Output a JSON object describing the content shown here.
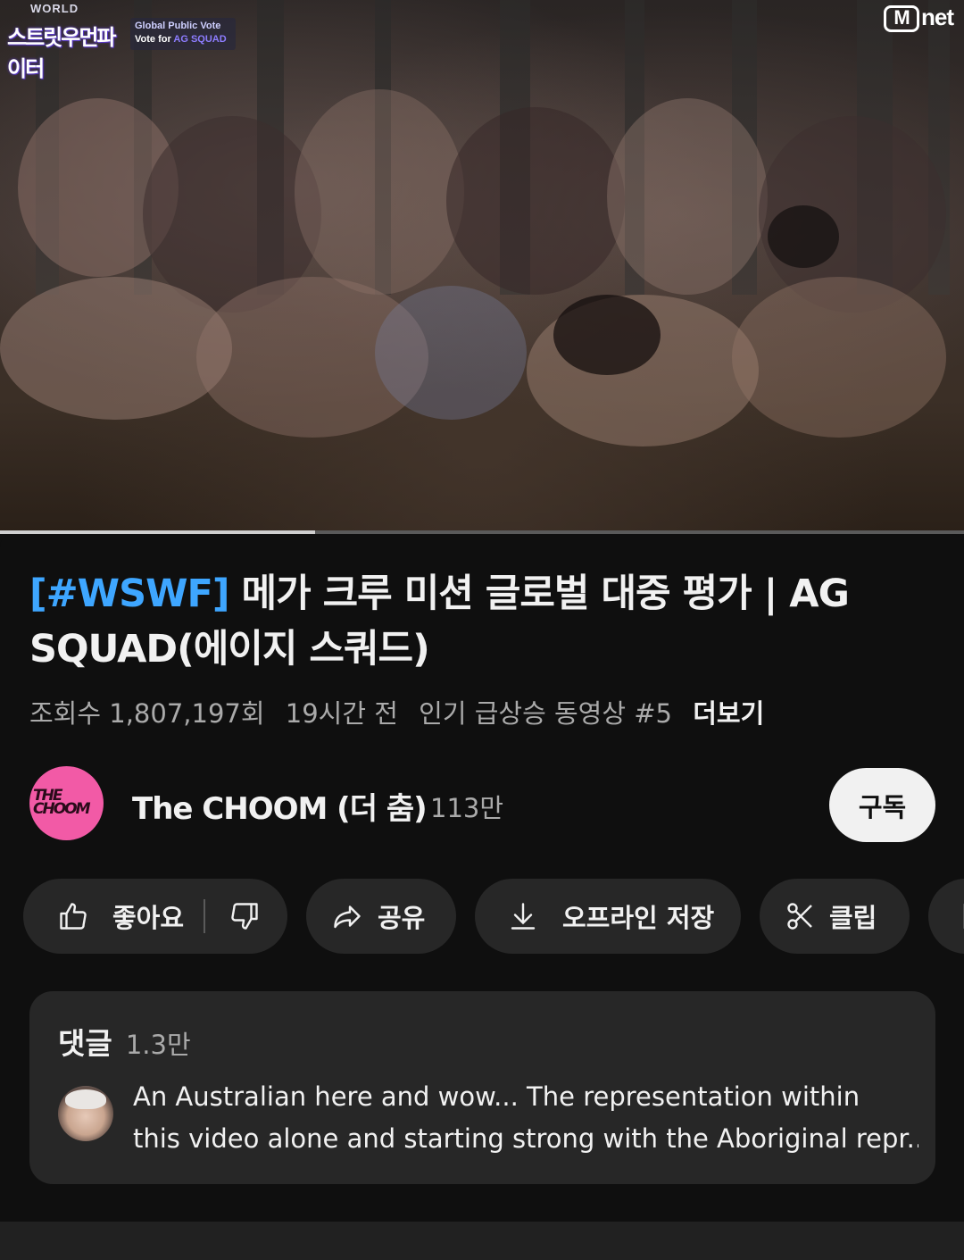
{
  "player": {
    "show_logo_top": "WORLD",
    "show_logo_main": "스트릿우먼파이터",
    "vote_line1": "Global Public Vote",
    "vote_line2_prefix": "Vote for ",
    "vote_line2_highlight": "AG SQUAD",
    "broadcaster_logo_m": "M",
    "broadcaster_logo_rest": "net",
    "progress": 0.327
  },
  "video": {
    "title_tag": "[#WSWF]",
    "title_text": " 메가 크루 미션 글로벌 대중 평가 | AG SQUAD(에이지 스쿼드)",
    "views": "조회수 1,807,197회",
    "time": "19시간 전",
    "trending": "인기 급상승 동영상 #5",
    "more": "더보기"
  },
  "channel": {
    "avatar_text_line1": "THE",
    "avatar_text_line2": "CHOOM",
    "name": "The CHOOM (더 춤)",
    "subscribers": "113만",
    "subscribe_label": "구독"
  },
  "actions": {
    "like_label": "좋아요",
    "share_label": "공유",
    "download_label": "오프라인 저장",
    "clip_label": "클립"
  },
  "comments": {
    "title": "댓글",
    "count": "1.3만",
    "top_comment_line1": "An Australian here and wow... The representation within",
    "top_comment_line2": "this video alone and starting strong with the Aboriginal repr..."
  },
  "colors": {
    "background": "#0f0f0f",
    "hashtag": "#3ea6ff",
    "pill": "#272727",
    "channel_avatar": "#f25aa6",
    "secondary_text": "#aaaaaa"
  },
  "icons": [
    "thumbs-up-icon",
    "thumbs-down-icon",
    "share-icon",
    "download-icon",
    "scissors-icon",
    "save-icon"
  ]
}
